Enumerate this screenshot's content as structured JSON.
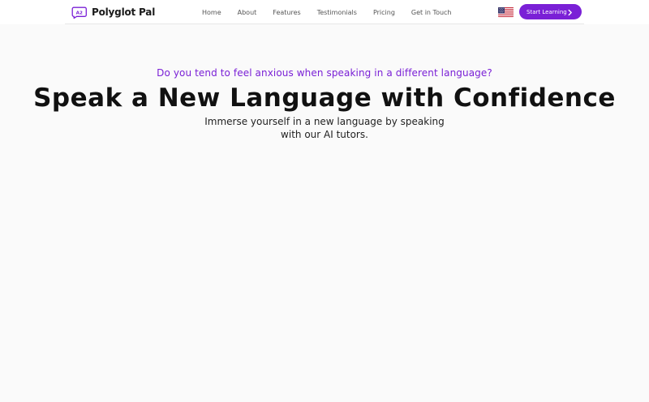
{
  "header": {
    "brand": {
      "name": "Polyglot Pal",
      "logo_text": "A2",
      "logo_icon": "language-chat-logo-icon"
    },
    "nav": [
      {
        "label": "Home"
      },
      {
        "label": "About"
      },
      {
        "label": "Features"
      },
      {
        "label": "Testimonials"
      },
      {
        "label": "Pricing"
      },
      {
        "label": "Get in Touch"
      }
    ],
    "language_flag": "us-flag-icon",
    "cta": {
      "label": "Start Learning",
      "icon": "chevron-right-icon"
    }
  },
  "hero": {
    "eyebrow": "Do you tend to feel anxious when speaking in a different language?",
    "headline": "Speak a New Language with Confidence",
    "subtext": "Immerse yourself in a new language by speaking with our AI tutors."
  },
  "colors": {
    "accent": "#7a20d6",
    "background": "#fafafa",
    "header_background": "#ffffff",
    "text_dark": "#111111",
    "nav_text": "#555555"
  }
}
